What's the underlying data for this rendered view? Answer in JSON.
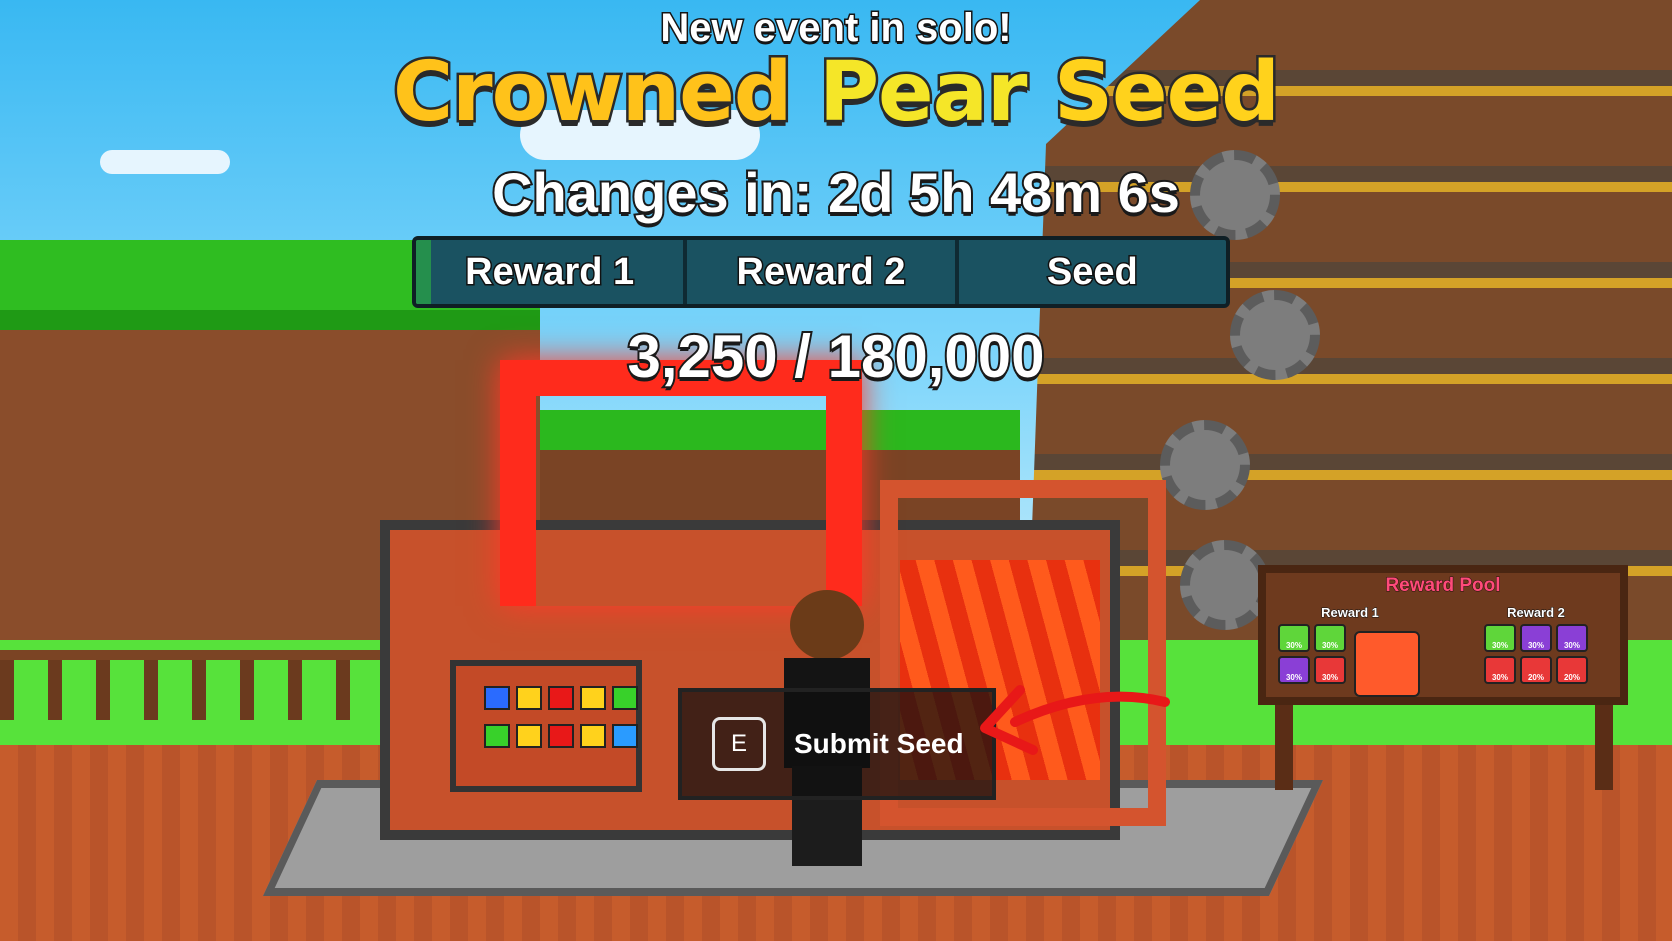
{
  "hud": {
    "event_subtitle": "New event in solo!",
    "event_title": "Crowned Pear Seed",
    "countdown": "Changes in: 2d 5h 48m 6s",
    "progress_segments": [
      {
        "label": "Reward 1"
      },
      {
        "label": "Reward 2"
      },
      {
        "label": "Seed"
      }
    ],
    "progress_current": "3,250",
    "progress_total": "180,000",
    "progress_text": "3,250 / 180,000",
    "progress_fraction": 0.018
  },
  "prompt": {
    "key": "E",
    "label": "Submit Seed"
  },
  "reward_board": {
    "title": "Reward Pool",
    "columns": [
      {
        "title": "Reward 1",
        "tiles": [
          "30%",
          "30%",
          "30%",
          "30%"
        ]
      },
      {
        "title": "Reward 2",
        "tiles": [
          "30%",
          "30%",
          "30%",
          "30%",
          "20%",
          "20%"
        ]
      }
    ]
  },
  "colors": {
    "title_yellow": "#ffd21c",
    "progress_green": "#2fd12b",
    "bar_teal": "#174a58",
    "arrow_red": "#e81818"
  }
}
